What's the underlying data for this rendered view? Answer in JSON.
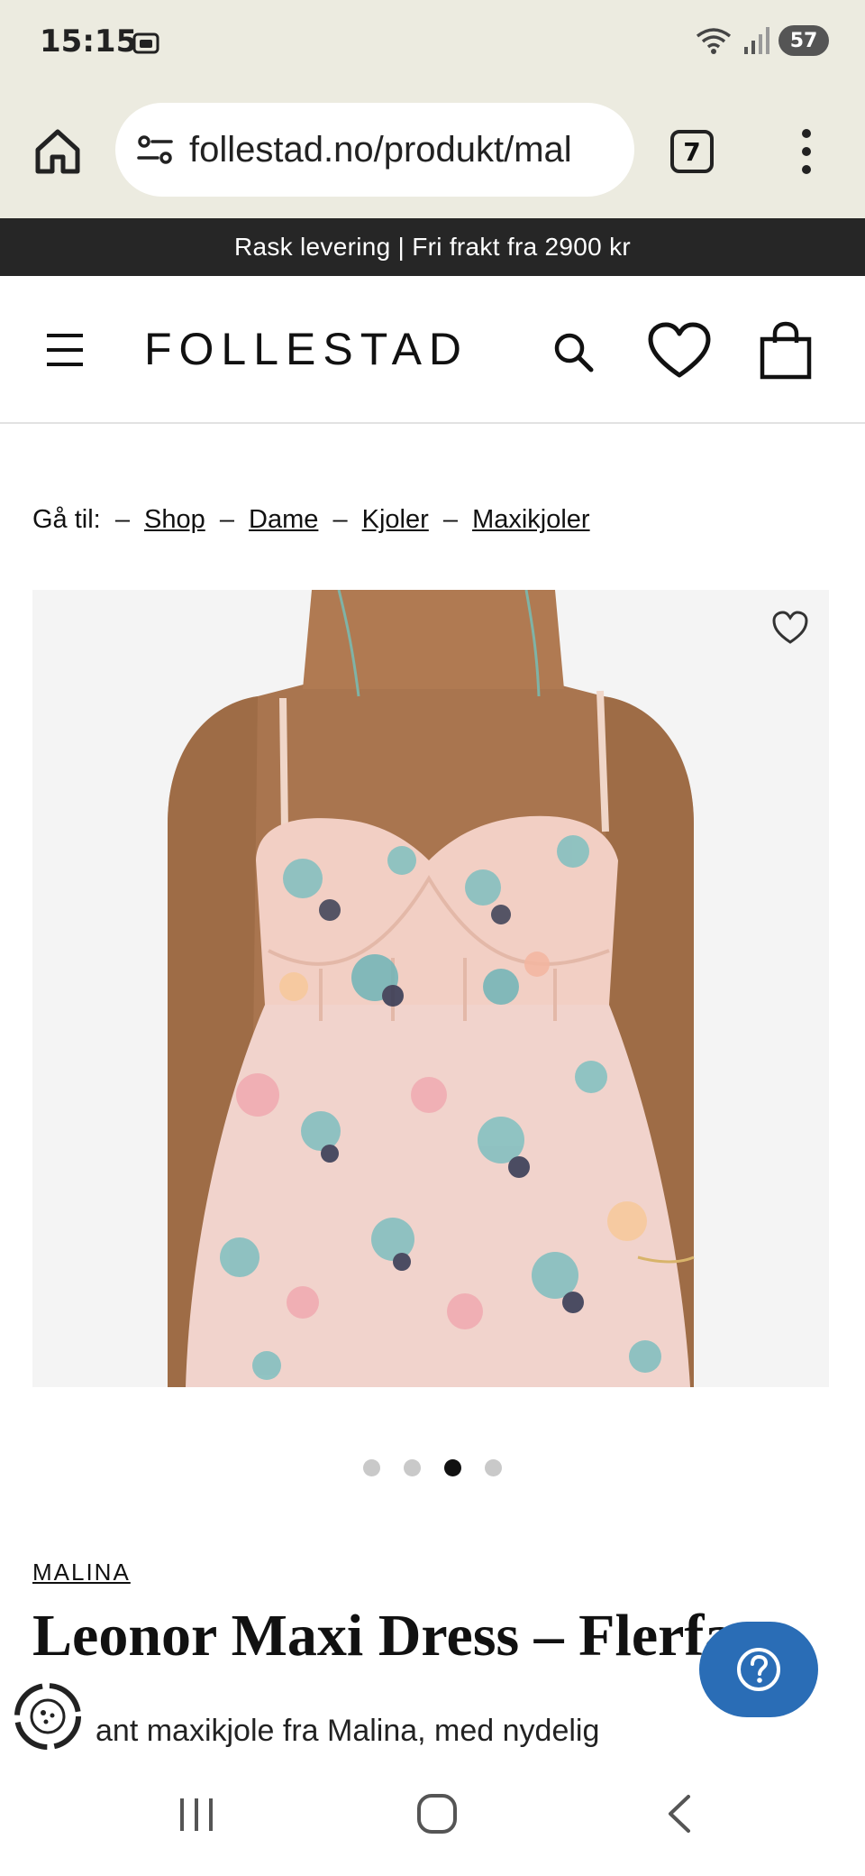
{
  "status_bar": {
    "time": "15:15",
    "battery": "57",
    "icons": [
      "photo-notification-icon",
      "wifi-icon",
      "signal-icon",
      "battery-icon"
    ]
  },
  "browser": {
    "url": "follestad.no/produkt/mal",
    "tab_count": "7",
    "icons": [
      "home-icon",
      "site-info-icon",
      "tabs-icon",
      "overflow-menu-icon"
    ]
  },
  "announcement": {
    "text": "Rask levering | Fri frakt fra 2900 kr"
  },
  "header": {
    "logo": "FOLLESTAD",
    "icons": [
      "menu-icon",
      "search-icon",
      "heart-icon",
      "bag-icon"
    ]
  },
  "breadcrumb": {
    "prefix": "Gå til:",
    "separator": "–",
    "items": [
      "Shop",
      "Dame",
      "Kjoler",
      "Maxikjoler"
    ]
  },
  "gallery": {
    "image_count": 4,
    "active_index": 2,
    "wishlist_icon": "heart-outline-icon"
  },
  "product": {
    "brand": "MALINA",
    "title": "Leonor Maxi Dress – Flerfa",
    "description": "ant maxikjole fra Malina, med nydelig"
  },
  "floating": {
    "help_icon": "question-icon",
    "cookie_icon": "cookie-settings-icon",
    "help_color": "#2a6db6"
  },
  "colors": {
    "browser_bg": "#ecebe0",
    "announcement_bg": "#262626",
    "accent": "#2a6db6"
  }
}
